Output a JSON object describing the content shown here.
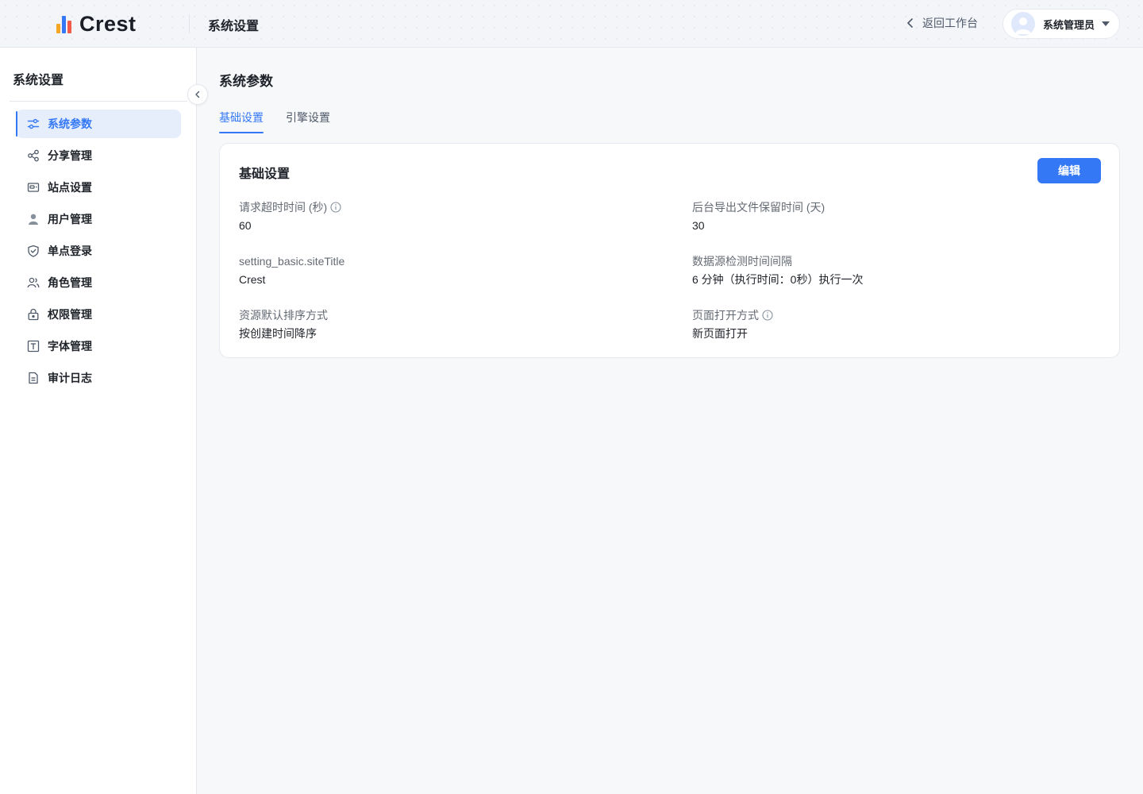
{
  "app": {
    "logo_text": "Crest",
    "header_title": "系统设置",
    "back_label": "返回工作台",
    "user_name": "系统管理员"
  },
  "sidebar": {
    "title": "系统设置",
    "items": [
      {
        "label": "系统参数",
        "icon": "sliders-icon",
        "active": true
      },
      {
        "label": "分享管理",
        "icon": "share-icon",
        "active": false
      },
      {
        "label": "站点设置",
        "icon": "site-icon",
        "active": false
      },
      {
        "label": "用户管理",
        "icon": "user-icon",
        "active": false
      },
      {
        "label": "单点登录",
        "icon": "shield-icon",
        "active": false
      },
      {
        "label": "角色管理",
        "icon": "users-icon",
        "active": false
      },
      {
        "label": "权限管理",
        "icon": "lock-icon",
        "active": false
      },
      {
        "label": "字体管理",
        "icon": "font-icon",
        "active": false
      },
      {
        "label": "审计日志",
        "icon": "document-icon",
        "active": false
      }
    ]
  },
  "main": {
    "page_title": "系统参数",
    "tabs": [
      {
        "label": "基础设置",
        "active": true
      },
      {
        "label": "引擎设置",
        "active": false
      }
    ],
    "card": {
      "title": "基础设置",
      "edit_label": "编辑",
      "fields": [
        {
          "label": "请求超时时间 (秒)",
          "value": "60",
          "info": true
        },
        {
          "label": "后台导出文件保留时间 (天)",
          "value": "30",
          "info": false
        },
        {
          "label": "setting_basic.siteTitle",
          "value": "Crest",
          "info": false
        },
        {
          "label": "数据源检测时间间隔",
          "value": "6 分钟（执行时间：0秒）执行一次",
          "info": false
        },
        {
          "label": "资源默认排序方式",
          "value": "按创建时间降序",
          "info": false
        },
        {
          "label": "页面打开方式",
          "value": "新页面打开",
          "info": true
        }
      ]
    }
  },
  "colors": {
    "accent": "#3478f6",
    "active_bg": "#e6eefc",
    "text": "#1f2329",
    "muted": "#646a73"
  }
}
